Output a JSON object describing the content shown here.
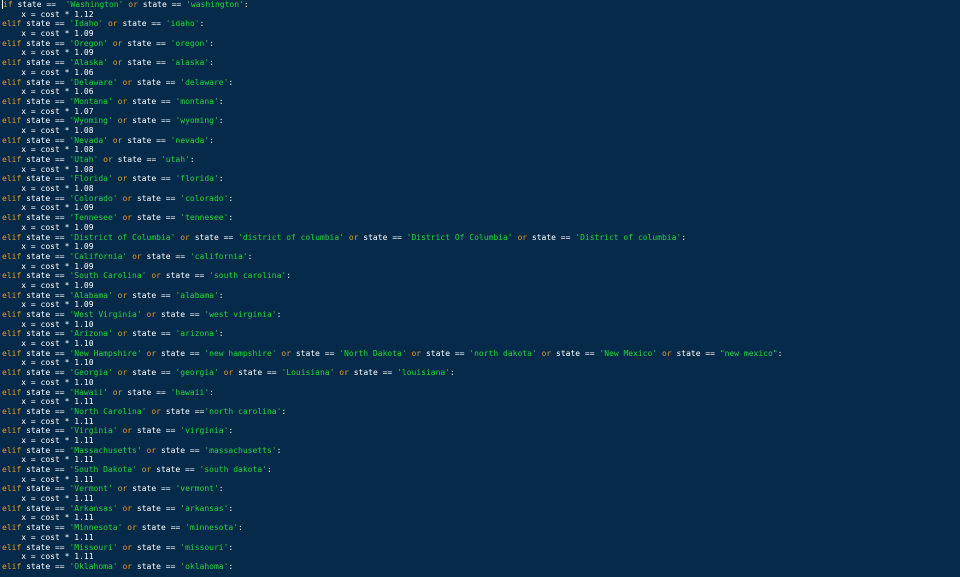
{
  "colors": {
    "background": "#062a4a",
    "keyword": "#e39a2e",
    "string": "#22d63a",
    "plain": "#ffffff"
  },
  "lines": [
    [
      [
        "kw",
        "if"
      ],
      [
        "txt",
        " state ==  "
      ],
      [
        "str",
        "'Washington'"
      ],
      [
        "txt",
        " "
      ],
      [
        "kw",
        "or"
      ],
      [
        "txt",
        " state == "
      ],
      [
        "str",
        "'washington'"
      ],
      [
        "txt",
        ":"
      ]
    ],
    [
      [
        "txt",
        "    x = cost * "
      ],
      [
        "num",
        "1.12"
      ]
    ],
    [
      [
        "kw",
        "elif"
      ],
      [
        "txt",
        " state == "
      ],
      [
        "str",
        "'Idaho'"
      ],
      [
        "txt",
        " "
      ],
      [
        "kw",
        "or"
      ],
      [
        "txt",
        " state == "
      ],
      [
        "str",
        "'idaho'"
      ],
      [
        "txt",
        ":"
      ]
    ],
    [
      [
        "txt",
        "    x = cost * "
      ],
      [
        "num",
        "1.09"
      ]
    ],
    [
      [
        "kw",
        "elif"
      ],
      [
        "txt",
        " state == "
      ],
      [
        "str",
        "'Oregon'"
      ],
      [
        "txt",
        " "
      ],
      [
        "kw",
        "or"
      ],
      [
        "txt",
        " state == "
      ],
      [
        "str",
        "'oregon'"
      ],
      [
        "txt",
        ":"
      ]
    ],
    [
      [
        "txt",
        "    x = cost * "
      ],
      [
        "num",
        "1.09"
      ]
    ],
    [
      [
        "kw",
        "elif"
      ],
      [
        "txt",
        " state == "
      ],
      [
        "str",
        "'Alaska'"
      ],
      [
        "txt",
        " "
      ],
      [
        "kw",
        "or"
      ],
      [
        "txt",
        " state == "
      ],
      [
        "str",
        "'alaska'"
      ],
      [
        "txt",
        ":"
      ]
    ],
    [
      [
        "txt",
        "    x = cost * "
      ],
      [
        "num",
        "1.06"
      ]
    ],
    [
      [
        "kw",
        "elif"
      ],
      [
        "txt",
        " state == "
      ],
      [
        "str",
        "'Delaware'"
      ],
      [
        "txt",
        " "
      ],
      [
        "kw",
        "or"
      ],
      [
        "txt",
        " state == "
      ],
      [
        "str",
        "'delaware'"
      ],
      [
        "txt",
        ":"
      ]
    ],
    [
      [
        "txt",
        "    x = cost * "
      ],
      [
        "num",
        "1.06"
      ]
    ],
    [
      [
        "kw",
        "elif"
      ],
      [
        "txt",
        " state == "
      ],
      [
        "str",
        "'Montana'"
      ],
      [
        "txt",
        " "
      ],
      [
        "kw",
        "or"
      ],
      [
        "txt",
        " state == "
      ],
      [
        "str",
        "'montana'"
      ],
      [
        "txt",
        ":"
      ]
    ],
    [
      [
        "txt",
        "    x = cost * "
      ],
      [
        "num",
        "1.07"
      ]
    ],
    [
      [
        "kw",
        "elif"
      ],
      [
        "txt",
        " state == "
      ],
      [
        "str",
        "'Wyoming'"
      ],
      [
        "txt",
        " "
      ],
      [
        "kw",
        "or"
      ],
      [
        "txt",
        " state == "
      ],
      [
        "str",
        "'wyoming'"
      ],
      [
        "txt",
        ":"
      ]
    ],
    [
      [
        "txt",
        "    x = cost * "
      ],
      [
        "num",
        "1.08"
      ]
    ],
    [
      [
        "kw",
        "elif"
      ],
      [
        "txt",
        " state == "
      ],
      [
        "str",
        "'Nevada'"
      ],
      [
        "txt",
        " "
      ],
      [
        "kw",
        "or"
      ],
      [
        "txt",
        " state == "
      ],
      [
        "str",
        "'nevada'"
      ],
      [
        "txt",
        ":"
      ]
    ],
    [
      [
        "txt",
        "    x = cost * "
      ],
      [
        "num",
        "1.08"
      ]
    ],
    [
      [
        "kw",
        "elif"
      ],
      [
        "txt",
        " state == "
      ],
      [
        "str",
        "'Utah'"
      ],
      [
        "txt",
        " "
      ],
      [
        "kw",
        "or"
      ],
      [
        "txt",
        " state == "
      ],
      [
        "str",
        "'utah'"
      ],
      [
        "txt",
        ":"
      ]
    ],
    [
      [
        "txt",
        "    x = cost * "
      ],
      [
        "num",
        "1.08"
      ]
    ],
    [
      [
        "kw",
        "elif"
      ],
      [
        "txt",
        " state == "
      ],
      [
        "str",
        "'Florida'"
      ],
      [
        "txt",
        " "
      ],
      [
        "kw",
        "or"
      ],
      [
        "txt",
        " state == "
      ],
      [
        "str",
        "'florida'"
      ],
      [
        "txt",
        ":"
      ]
    ],
    [
      [
        "txt",
        "    x = cost * "
      ],
      [
        "num",
        "1.08"
      ]
    ],
    [
      [
        "kw",
        "elif"
      ],
      [
        "txt",
        " state == "
      ],
      [
        "str",
        "'Colorado'"
      ],
      [
        "txt",
        " "
      ],
      [
        "kw",
        "or"
      ],
      [
        "txt",
        " state == "
      ],
      [
        "str",
        "'colorado'"
      ],
      [
        "txt",
        ":"
      ]
    ],
    [
      [
        "txt",
        "    x = cost * "
      ],
      [
        "num",
        "1.09"
      ]
    ],
    [
      [
        "kw",
        "elif"
      ],
      [
        "txt",
        " state == "
      ],
      [
        "str",
        "'Tennesee'"
      ],
      [
        "txt",
        " "
      ],
      [
        "kw",
        "or"
      ],
      [
        "txt",
        " state == "
      ],
      [
        "str",
        "'tennesee'"
      ],
      [
        "txt",
        ":"
      ]
    ],
    [
      [
        "txt",
        "    x = cost * "
      ],
      [
        "num",
        "1.09"
      ]
    ],
    [
      [
        "kw",
        "elif"
      ],
      [
        "txt",
        " state == "
      ],
      [
        "str",
        "'District of Columbia'"
      ],
      [
        "txt",
        " "
      ],
      [
        "kw",
        "or"
      ],
      [
        "txt",
        " state == "
      ],
      [
        "str",
        "'district of columbia'"
      ],
      [
        "txt",
        " "
      ],
      [
        "kw",
        "or"
      ],
      [
        "txt",
        " state == "
      ],
      [
        "str",
        "'District Of Columbia'"
      ],
      [
        "txt",
        " "
      ],
      [
        "kw",
        "or"
      ],
      [
        "txt",
        " state == "
      ],
      [
        "str",
        "'District of columbia'"
      ],
      [
        "txt",
        ":"
      ]
    ],
    [
      [
        "txt",
        "    x = cost * "
      ],
      [
        "num",
        "1.09"
      ]
    ],
    [
      [
        "kw",
        "elif"
      ],
      [
        "txt",
        " state == "
      ],
      [
        "str",
        "'California'"
      ],
      [
        "txt",
        " "
      ],
      [
        "kw",
        "or"
      ],
      [
        "txt",
        " state == "
      ],
      [
        "str",
        "'california'"
      ],
      [
        "txt",
        ":"
      ]
    ],
    [
      [
        "txt",
        "    x = cost * "
      ],
      [
        "num",
        "1.09"
      ]
    ],
    [
      [
        "kw",
        "elif"
      ],
      [
        "txt",
        " state == "
      ],
      [
        "str",
        "'South Carolina'"
      ],
      [
        "txt",
        " "
      ],
      [
        "kw",
        "or"
      ],
      [
        "txt",
        " state == "
      ],
      [
        "str",
        "'south carolina'"
      ],
      [
        "txt",
        ":"
      ]
    ],
    [
      [
        "txt",
        "    x = cost * "
      ],
      [
        "num",
        "1.09"
      ]
    ],
    [
      [
        "kw",
        "elif"
      ],
      [
        "txt",
        " state == "
      ],
      [
        "str",
        "'Alabama'"
      ],
      [
        "txt",
        " "
      ],
      [
        "kw",
        "or"
      ],
      [
        "txt",
        " state == "
      ],
      [
        "str",
        "'alabama'"
      ],
      [
        "txt",
        ":"
      ]
    ],
    [
      [
        "txt",
        "    x = cost * "
      ],
      [
        "num",
        "1.09"
      ]
    ],
    [
      [
        "kw",
        "elif"
      ],
      [
        "txt",
        " state == "
      ],
      [
        "str",
        "'West Virginia'"
      ],
      [
        "txt",
        " "
      ],
      [
        "kw",
        "or"
      ],
      [
        "txt",
        " state == "
      ],
      [
        "str",
        "'west virginia'"
      ],
      [
        "txt",
        ":"
      ]
    ],
    [
      [
        "txt",
        "    x = cost * "
      ],
      [
        "num",
        "1.10"
      ]
    ],
    [
      [
        "kw",
        "elif"
      ],
      [
        "txt",
        " state == "
      ],
      [
        "str",
        "'Arizona'"
      ],
      [
        "txt",
        " "
      ],
      [
        "kw",
        "or"
      ],
      [
        "txt",
        " state == "
      ],
      [
        "str",
        "'arizona'"
      ],
      [
        "txt",
        ":"
      ]
    ],
    [
      [
        "txt",
        "    x = cost * "
      ],
      [
        "num",
        "1.10"
      ]
    ],
    [
      [
        "kw",
        "elif"
      ],
      [
        "txt",
        " state == "
      ],
      [
        "str",
        "'New Hampshire'"
      ],
      [
        "txt",
        " "
      ],
      [
        "kw",
        "or"
      ],
      [
        "txt",
        " state == "
      ],
      [
        "str",
        "'new hampshire'"
      ],
      [
        "txt",
        " "
      ],
      [
        "kw",
        "or"
      ],
      [
        "txt",
        " state == "
      ],
      [
        "str",
        "'North Dakota'"
      ],
      [
        "txt",
        " "
      ],
      [
        "kw",
        "or"
      ],
      [
        "txt",
        " state == "
      ],
      [
        "str",
        "'north dakota'"
      ],
      [
        "txt",
        " "
      ],
      [
        "kw",
        "or"
      ],
      [
        "txt",
        " state == "
      ],
      [
        "str",
        "'New Mexico'"
      ],
      [
        "txt",
        " "
      ],
      [
        "kw",
        "or"
      ],
      [
        "txt",
        " state == "
      ],
      [
        "str",
        "\"new mexico\""
      ],
      [
        "txt",
        ":"
      ]
    ],
    [
      [
        "txt",
        "    x = cost * "
      ],
      [
        "num",
        "1.10"
      ]
    ],
    [
      [
        "kw",
        "elif"
      ],
      [
        "txt",
        " state == "
      ],
      [
        "str",
        "'Georgia'"
      ],
      [
        "txt",
        " "
      ],
      [
        "kw",
        "or"
      ],
      [
        "txt",
        " state == "
      ],
      [
        "str",
        "'georgia'"
      ],
      [
        "txt",
        " "
      ],
      [
        "kw",
        "or"
      ],
      [
        "txt",
        " state == "
      ],
      [
        "str",
        "'Louisiana'"
      ],
      [
        "txt",
        " "
      ],
      [
        "kw",
        "or"
      ],
      [
        "txt",
        " state == "
      ],
      [
        "str",
        "'louisiana'"
      ],
      [
        "txt",
        ":"
      ]
    ],
    [
      [
        "txt",
        "    x = cost * "
      ],
      [
        "num",
        "1.10"
      ]
    ],
    [
      [
        "kw",
        "elif"
      ],
      [
        "txt",
        " state == "
      ],
      [
        "str",
        "'Hawaii'"
      ],
      [
        "txt",
        " "
      ],
      [
        "kw",
        "or"
      ],
      [
        "txt",
        " state == "
      ],
      [
        "str",
        "'hawaii'"
      ],
      [
        "txt",
        ":"
      ]
    ],
    [
      [
        "txt",
        "    x = cost * "
      ],
      [
        "num",
        "1.11"
      ]
    ],
    [
      [
        "kw",
        "elif"
      ],
      [
        "txt",
        " state == "
      ],
      [
        "str",
        "'North Carolina'"
      ],
      [
        "txt",
        " "
      ],
      [
        "kw",
        "or"
      ],
      [
        "txt",
        " state =="
      ],
      [
        "str",
        "'north carolina'"
      ],
      [
        "txt",
        ":"
      ]
    ],
    [
      [
        "txt",
        "    x = cost * "
      ],
      [
        "num",
        "1.11"
      ]
    ],
    [
      [
        "kw",
        "elif"
      ],
      [
        "txt",
        " state == "
      ],
      [
        "str",
        "'Virginia'"
      ],
      [
        "txt",
        " "
      ],
      [
        "kw",
        "or"
      ],
      [
        "txt",
        " state == "
      ],
      [
        "str",
        "'virginia'"
      ],
      [
        "txt",
        ":"
      ]
    ],
    [
      [
        "txt",
        "    x = cost * "
      ],
      [
        "num",
        "1.11"
      ]
    ],
    [
      [
        "kw",
        "elif"
      ],
      [
        "txt",
        " state == "
      ],
      [
        "str",
        "'Massachusetts'"
      ],
      [
        "txt",
        " "
      ],
      [
        "kw",
        "or"
      ],
      [
        "txt",
        " state == "
      ],
      [
        "str",
        "'massachusetts'"
      ],
      [
        "txt",
        ":"
      ]
    ],
    [
      [
        "txt",
        "    x = cost * "
      ],
      [
        "num",
        "1.11"
      ]
    ],
    [
      [
        "kw",
        "elif"
      ],
      [
        "txt",
        " state == "
      ],
      [
        "str",
        "'South Dakota'"
      ],
      [
        "txt",
        " "
      ],
      [
        "kw",
        "or"
      ],
      [
        "txt",
        " state == "
      ],
      [
        "str",
        "'south dakota'"
      ],
      [
        "txt",
        ":"
      ]
    ],
    [
      [
        "txt",
        "    x = cost * "
      ],
      [
        "num",
        "1.11"
      ]
    ],
    [
      [
        "kw",
        "elif"
      ],
      [
        "txt",
        " state == "
      ],
      [
        "str",
        "'Vermont'"
      ],
      [
        "txt",
        " "
      ],
      [
        "kw",
        "or"
      ],
      [
        "txt",
        " state == "
      ],
      [
        "str",
        "'vermont'"
      ],
      [
        "txt",
        ":"
      ]
    ],
    [
      [
        "txt",
        "    x = cost * "
      ],
      [
        "num",
        "1.11"
      ]
    ],
    [
      [
        "kw",
        "elif"
      ],
      [
        "txt",
        " state == "
      ],
      [
        "str",
        "'Arkansas'"
      ],
      [
        "txt",
        " "
      ],
      [
        "kw",
        "or"
      ],
      [
        "txt",
        " state == "
      ],
      [
        "str",
        "'arkansas'"
      ],
      [
        "txt",
        ":"
      ]
    ],
    [
      [
        "txt",
        "    x = cost * "
      ],
      [
        "num",
        "1.11"
      ]
    ],
    [
      [
        "kw",
        "elif"
      ],
      [
        "txt",
        " state == "
      ],
      [
        "str",
        "'Minnesota'"
      ],
      [
        "txt",
        " "
      ],
      [
        "kw",
        "or"
      ],
      [
        "txt",
        " state == "
      ],
      [
        "str",
        "'minnesota'"
      ],
      [
        "txt",
        ":"
      ]
    ],
    [
      [
        "txt",
        "    x = cost * "
      ],
      [
        "num",
        "1.11"
      ]
    ],
    [
      [
        "kw",
        "elif"
      ],
      [
        "txt",
        " state == "
      ],
      [
        "str",
        "'Missouri'"
      ],
      [
        "txt",
        " "
      ],
      [
        "kw",
        "or"
      ],
      [
        "txt",
        " state == "
      ],
      [
        "str",
        "'missouri'"
      ],
      [
        "txt",
        ":"
      ]
    ],
    [
      [
        "txt",
        "    x = cost * "
      ],
      [
        "num",
        "1.11"
      ]
    ],
    [
      [
        "kw",
        "elif"
      ],
      [
        "txt",
        " state == "
      ],
      [
        "str",
        "'Oklahoma'"
      ],
      [
        "txt",
        " "
      ],
      [
        "kw",
        "or"
      ],
      [
        "txt",
        " state == "
      ],
      [
        "str",
        "'oklahoma'"
      ],
      [
        "txt",
        ":"
      ]
    ]
  ]
}
